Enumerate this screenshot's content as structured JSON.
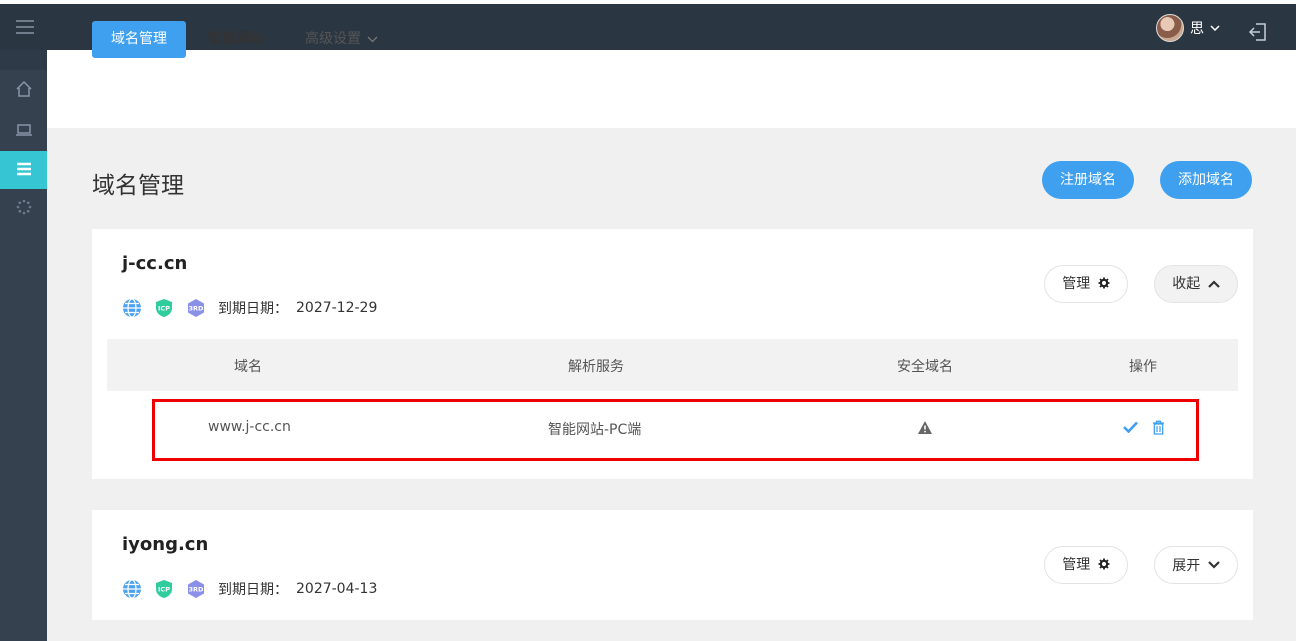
{
  "header": {
    "user_name": "思",
    "user_caret": "⌄"
  },
  "tabs": [
    {
      "label": "域名管理",
      "active": true
    },
    {
      "label": "智能网站",
      "active": false
    },
    {
      "label": "高级设置",
      "active": false
    }
  ],
  "page": {
    "title": "域名管理",
    "register_button": "注册域名",
    "add_button": "添加域名"
  },
  "table_headers": [
    "域名",
    "解析服务",
    "安全域名",
    "操作"
  ],
  "domains": [
    {
      "name": "j-cc.cn",
      "expire_label": "到期日期：",
      "expire_date": "2027-12-29",
      "manage_label": "管理",
      "toggle_label": "收起",
      "rows": [
        {
          "subdomain": "www.j-cc.cn",
          "service": "智能网站-PC端"
        }
      ]
    },
    {
      "name": "iyong.cn",
      "expire_label": "到期日期：",
      "expire_date": "2027-04-13",
      "manage_label": "管理",
      "toggle_label": "展开"
    }
  ],
  "colors": {
    "topbar": "#2b3643",
    "sidebar": "#364150",
    "sidebar_active": "#36c6d3",
    "primary": "#3fa0f0",
    "highlight": "#ee0000"
  },
  "icons": [
    "menu-icon",
    "home-icon",
    "laptop-icon",
    "list-icon",
    "spinner-icon",
    "logout-icon",
    "globe-icon",
    "icp-icon",
    "3rd-icon",
    "gear-icon",
    "chevron-up-icon",
    "chevron-down-icon",
    "warning-icon",
    "check-icon",
    "trash-icon"
  ]
}
